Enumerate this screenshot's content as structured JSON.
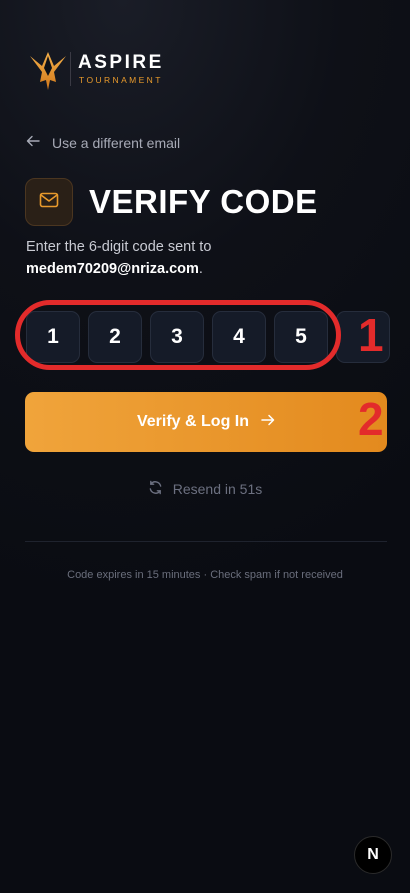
{
  "brand": {
    "name": "ASPIRE",
    "subtitle": "TOURNAMENT",
    "accent": "#e89a2c"
  },
  "back_link": {
    "label": "Use a different email",
    "icon": "arrow-left-icon"
  },
  "header": {
    "title": "VERIFY CODE",
    "icon": "mail-icon"
  },
  "description": {
    "text": "Enter the 6-digit code sent to",
    "email": "medem70209@nriza.com",
    "suffix": "."
  },
  "otp": {
    "digits": [
      "1",
      "2",
      "3",
      "4",
      "5",
      ""
    ]
  },
  "annotations": {
    "one": "1",
    "two": "2",
    "color": "#e32b2b"
  },
  "verify_button": {
    "label": "Verify & Log In",
    "icon": "arrow-right-icon"
  },
  "resend": {
    "label": "Resend in 51s",
    "icon": "refresh-icon"
  },
  "footer": {
    "text": "Code expires in 15 minutes · Check spam if not received"
  },
  "dev_badge": {
    "label": "N"
  }
}
